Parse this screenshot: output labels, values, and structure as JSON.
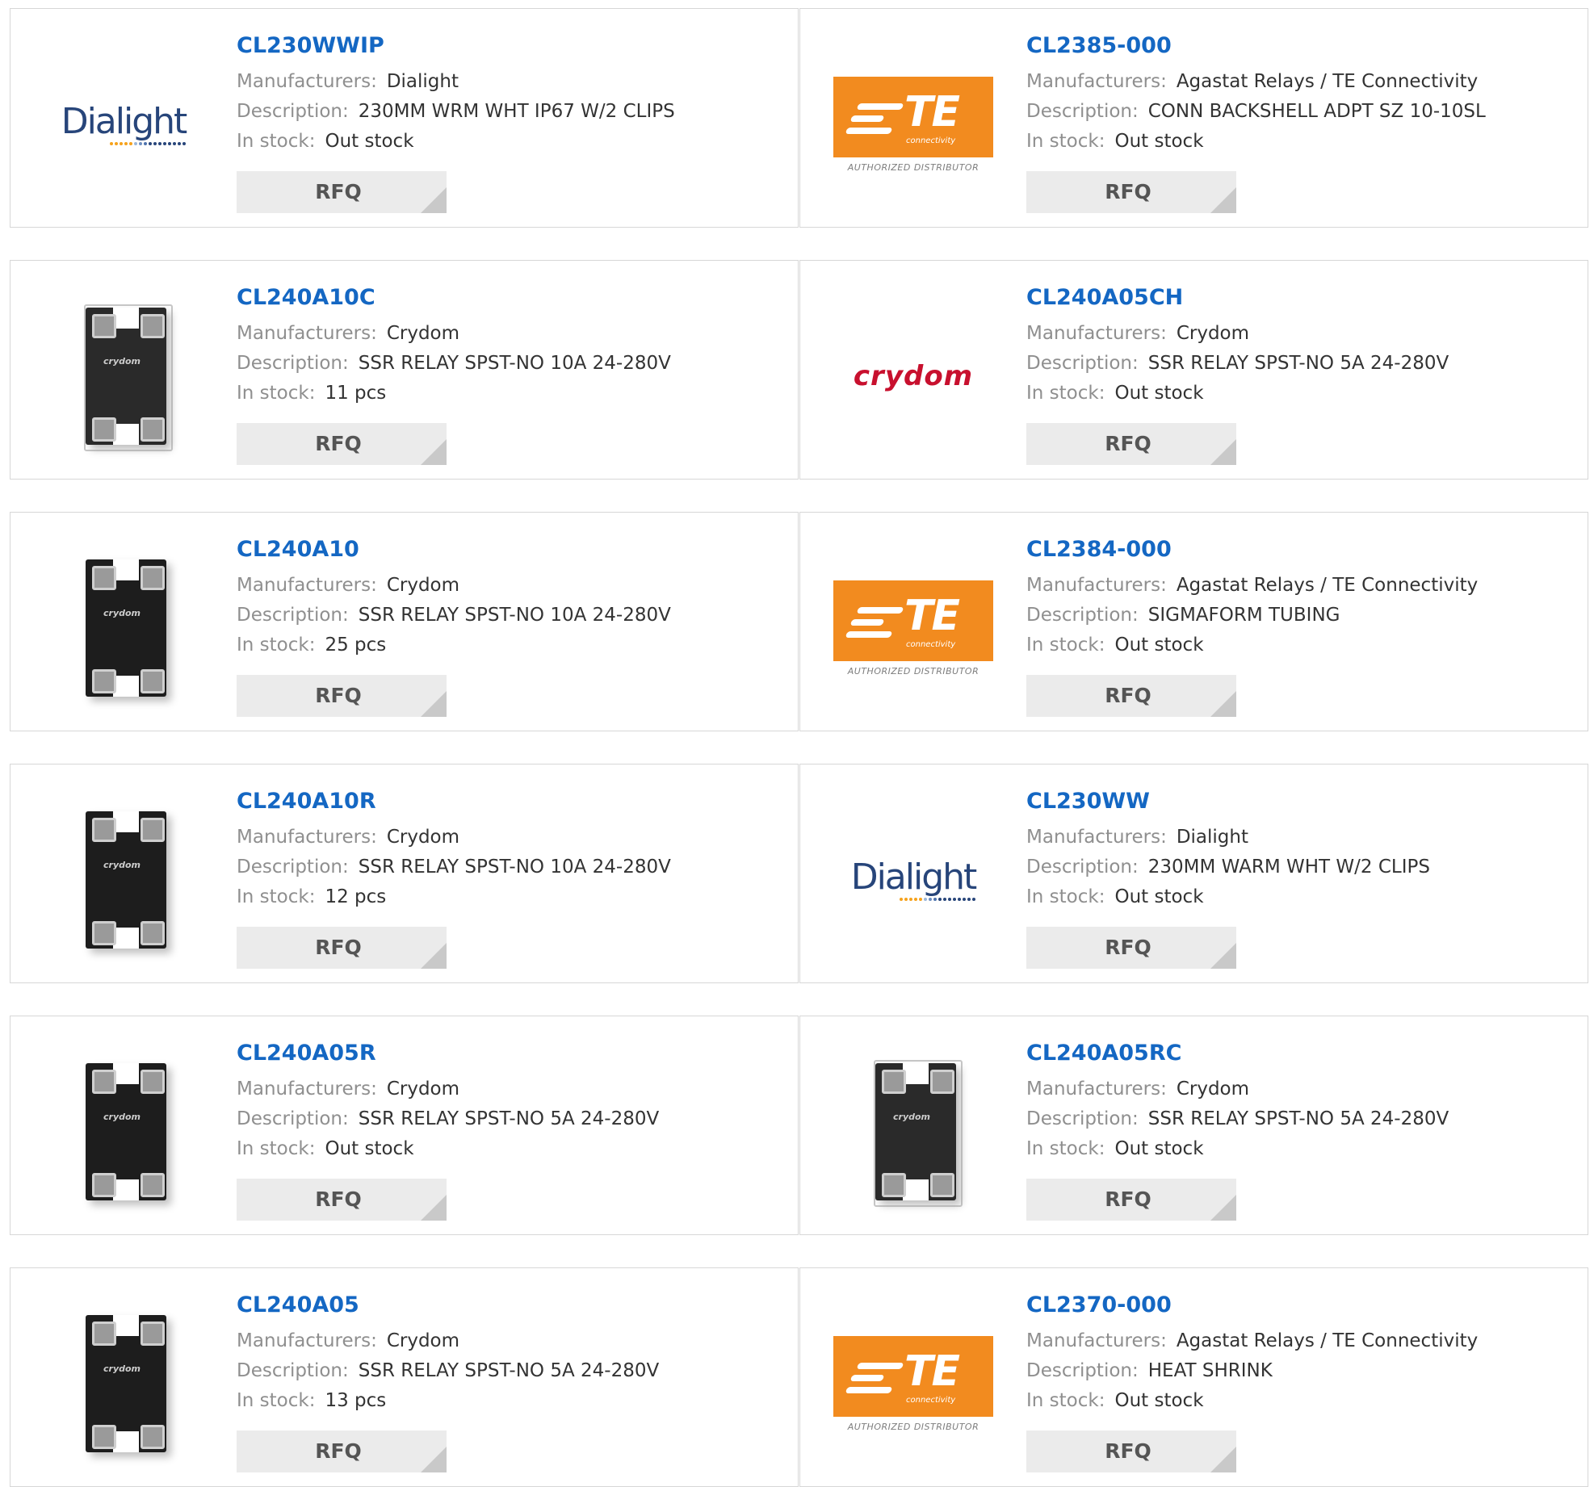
{
  "labels": {
    "manufacturers": "Manufacturers:",
    "description": "Description:",
    "in_stock": "In stock:",
    "rfq": "RFQ"
  },
  "logos": {
    "dialight_text": "Dialight",
    "te_text": "TE",
    "te_sub": "connectivity",
    "te_authorized": "AUTHORIZED DISTRIBUTOR",
    "crydom_text": "crydom",
    "relay_brand": "crydom"
  },
  "colors": {
    "part_link": "#1467c3",
    "te_orange": "#f28b1f",
    "dialight_blue": "#27457a",
    "crydom_red": "#c8102e",
    "rfq_bg": "#ebebeb"
  },
  "products": [
    {
      "part": "CL230WWIP",
      "manufacturer": "Dialight",
      "description": "230MM WRM WHT IP67 W/2 CLIPS",
      "stock": "Out stock",
      "image": "dialight-logo"
    },
    {
      "part": "CL2385-000",
      "manufacturer": "Agastat Relays / TE Connectivity",
      "description": "CONN BACKSHELL ADPT SZ 10-10SL",
      "stock": "Out stock",
      "image": "te-logo"
    },
    {
      "part": "CL240A10C",
      "manufacturer": "Crydom",
      "description": "SSR RELAY SPST-NO 10A 24-280V",
      "stock": "11 pcs",
      "image": "relay-clear"
    },
    {
      "part": "CL240A05CH",
      "manufacturer": "Crydom",
      "description": "SSR RELAY SPST-NO 5A 24-280V",
      "stock": "Out stock",
      "image": "crydom-logo"
    },
    {
      "part": "CL240A10",
      "manufacturer": "Crydom",
      "description": "SSR RELAY SPST-NO 10A 24-280V",
      "stock": "25 pcs",
      "image": "relay-black"
    },
    {
      "part": "CL2384-000",
      "manufacturer": "Agastat Relays / TE Connectivity",
      "description": "SIGMAFORM TUBING",
      "stock": "Out stock",
      "image": "te-logo"
    },
    {
      "part": "CL240A10R",
      "manufacturer": "Crydom",
      "description": "SSR RELAY SPST-NO 10A 24-280V",
      "stock": "12 pcs",
      "image": "relay-black"
    },
    {
      "part": "CL230WW",
      "manufacturer": "Dialight",
      "description": "230MM WARM WHT W/2 CLIPS",
      "stock": "Out stock",
      "image": "dialight-logo"
    },
    {
      "part": "CL240A05R",
      "manufacturer": "Crydom",
      "description": "SSR RELAY SPST-NO 5A 24-280V",
      "stock": "Out stock",
      "image": "relay-black"
    },
    {
      "part": "CL240A05RC",
      "manufacturer": "Crydom",
      "description": "SSR RELAY SPST-NO 5A 24-280V",
      "stock": "Out stock",
      "image": "relay-clear"
    },
    {
      "part": "CL240A05",
      "manufacturer": "Crydom",
      "description": "SSR RELAY SPST-NO 5A 24-280V",
      "stock": "13 pcs",
      "image": "relay-black"
    },
    {
      "part": "CL2370-000",
      "manufacturer": "Agastat Relays / TE Connectivity",
      "description": "HEAT SHRINK",
      "stock": "Out stock",
      "image": "te-logo"
    }
  ]
}
